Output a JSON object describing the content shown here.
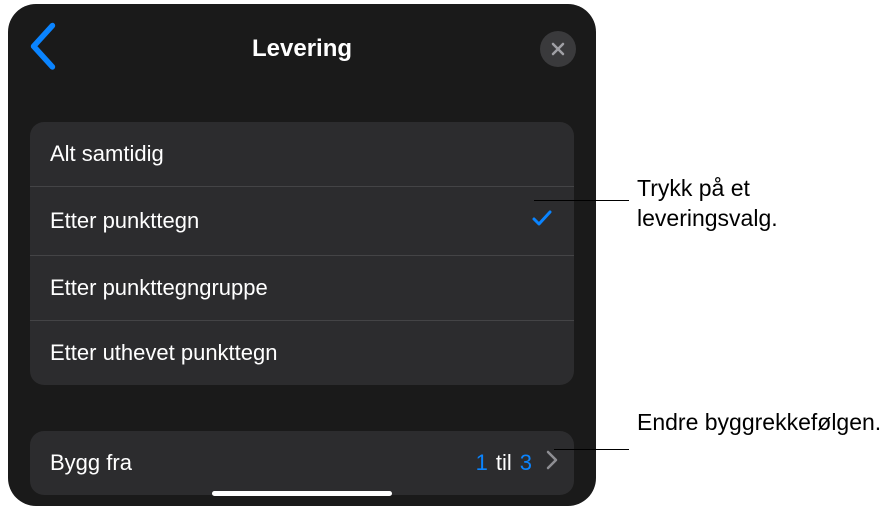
{
  "header": {
    "title": "Levering"
  },
  "options": [
    {
      "label": "Alt samtidig",
      "selected": false
    },
    {
      "label": "Etter punkttegn",
      "selected": true
    },
    {
      "label": "Etter punkttegngruppe",
      "selected": false
    },
    {
      "label": "Etter uthevet punkttegn",
      "selected": false
    }
  ],
  "build": {
    "label": "Bygg fra",
    "from": "1",
    "separator": "til",
    "to": "3"
  },
  "callouts": {
    "delivery": "Trykk på et leveringsvalg.",
    "order": "Endre byggrekkefølgen."
  }
}
